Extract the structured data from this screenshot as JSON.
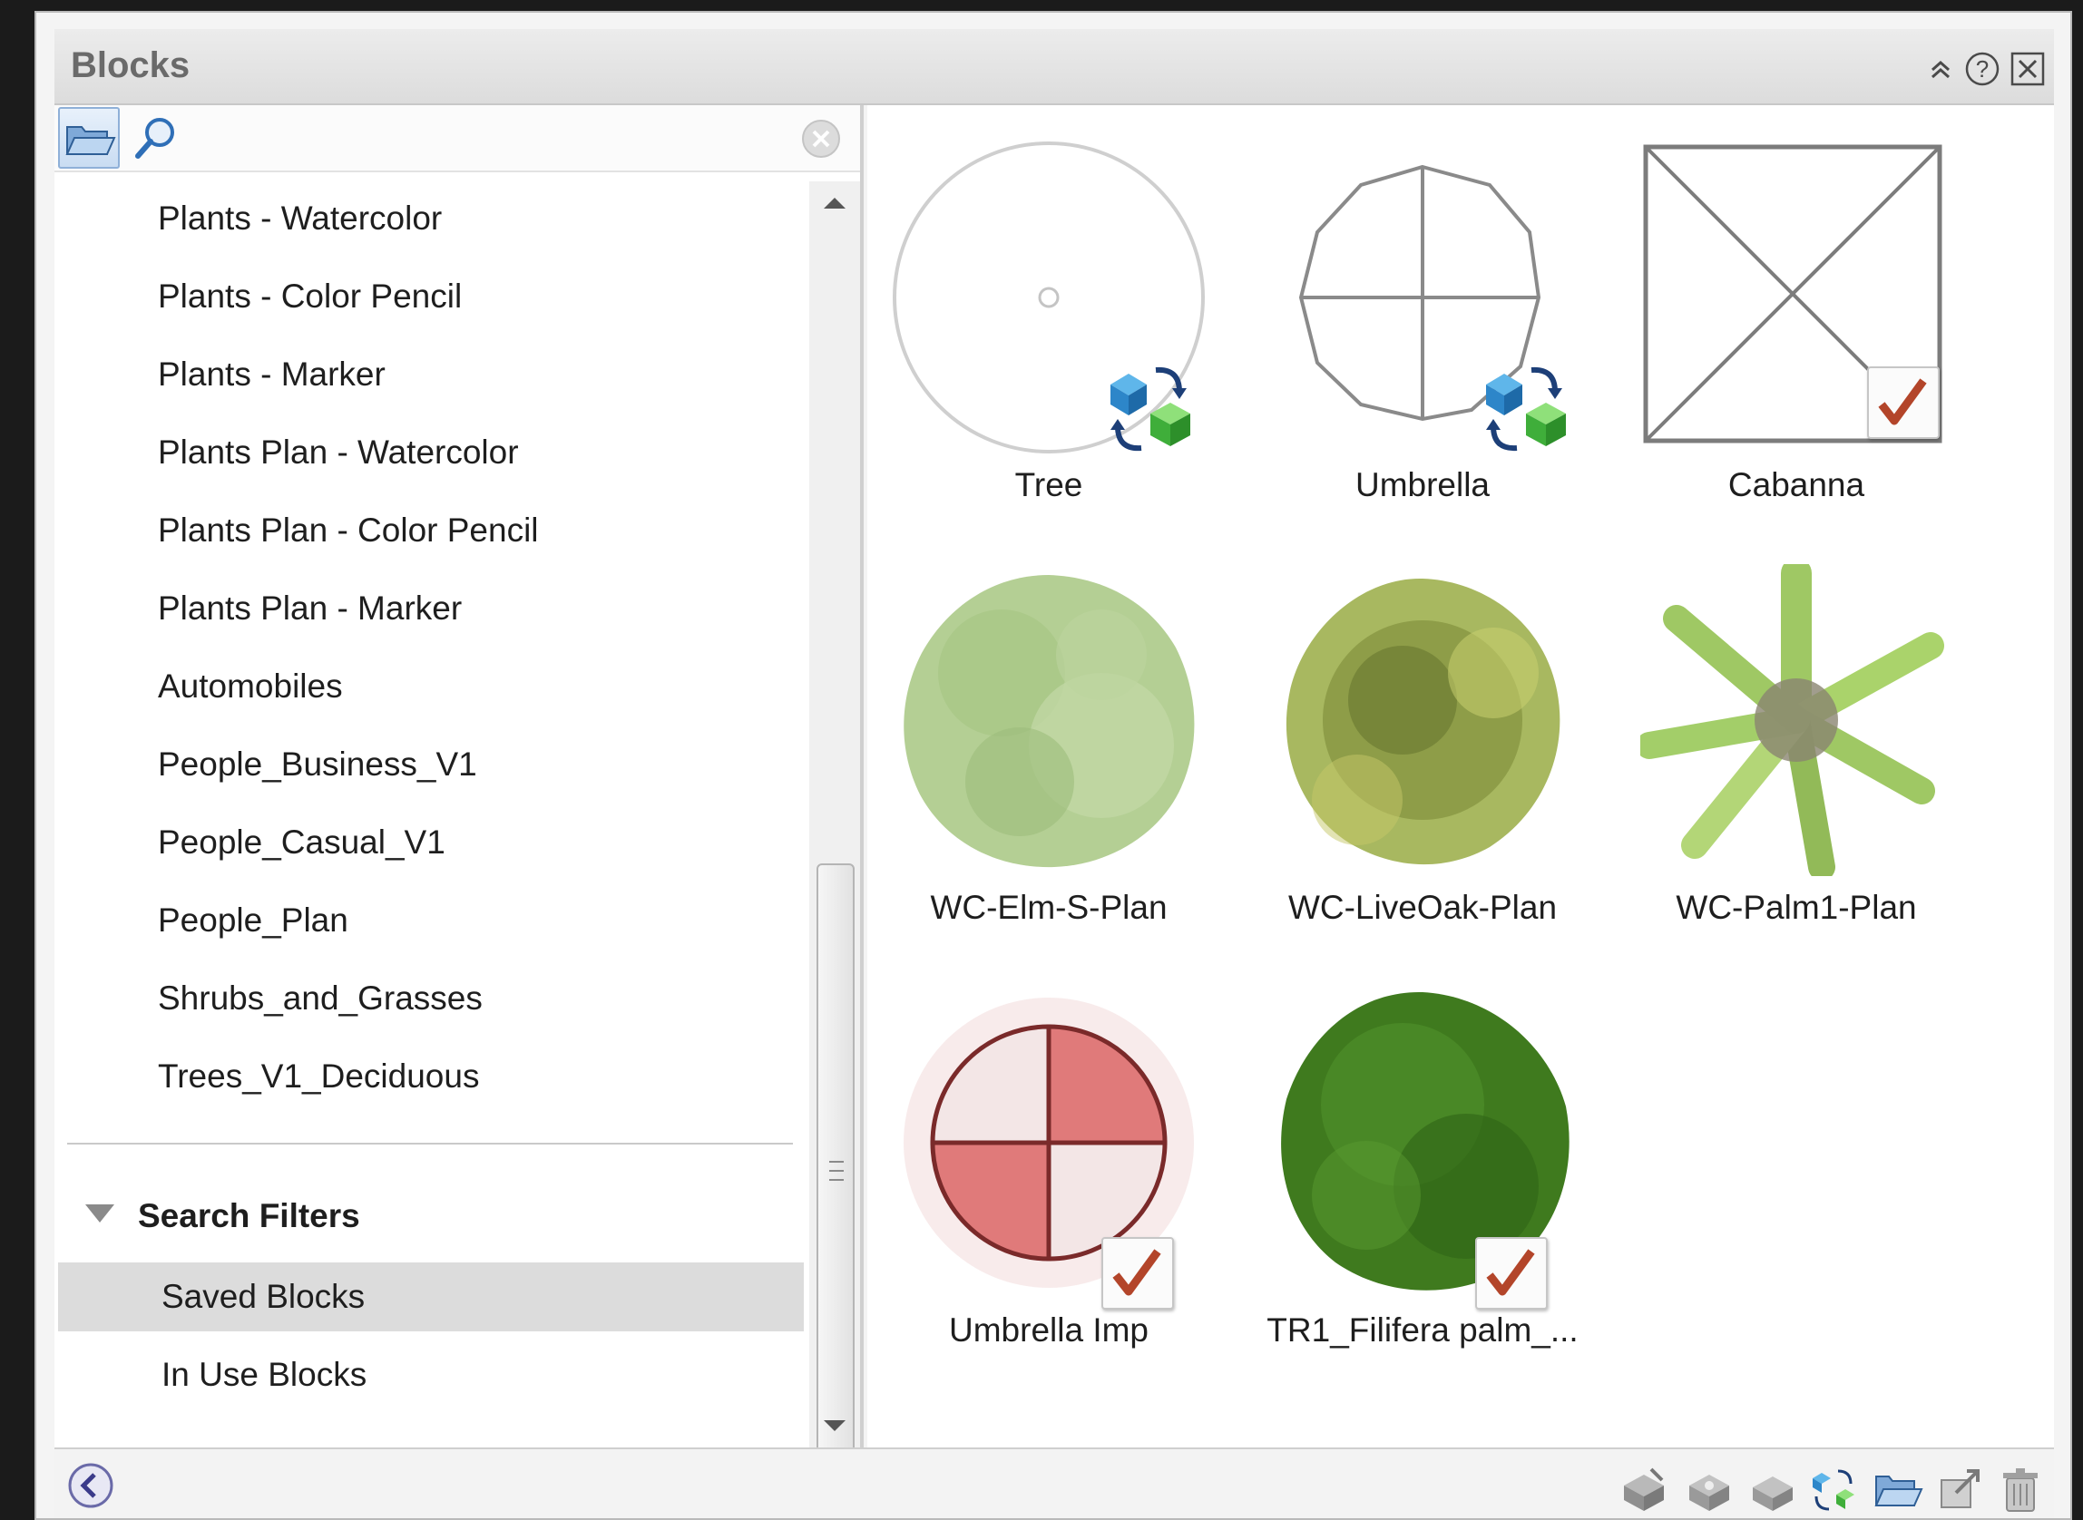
{
  "panel": {
    "title": "Blocks"
  },
  "window_controls": [
    "collapse-icon",
    "help-icon",
    "close-icon"
  ],
  "toolbar": {
    "folder_icon": "folder-open-icon",
    "search_icon": "magnifier-icon",
    "search_placeholder": "",
    "clear_icon": "clear-icon"
  },
  "libraries": [
    "Plants - Watercolor",
    "Plants - Color Pencil",
    "Plants - Marker",
    "Plants Plan - Watercolor",
    "Plants Plan - Color Pencil",
    "Plants Plan - Marker",
    "Automobiles",
    "People_Business_V1",
    "People_Casual_V1",
    "People_Plan",
    "Shrubs_and_Grasses",
    "Trees_V1_Deciduous"
  ],
  "search_filters": {
    "label": "Search Filters",
    "items": [
      {
        "label": "Saved Blocks",
        "selected": true
      },
      {
        "label": "In Use Blocks",
        "selected": false
      }
    ]
  },
  "blocks": [
    {
      "label": "Tree",
      "badge": "sync-icon"
    },
    {
      "label": "Umbrella",
      "badge": "sync-icon"
    },
    {
      "label": "Cabanna",
      "badge": "checkmark-icon"
    },
    {
      "label": "WC-Elm-S-Plan",
      "badge": ""
    },
    {
      "label": "WC-LiveOak-Plan",
      "badge": ""
    },
    {
      "label": "WC-Palm1-Plan",
      "badge": ""
    },
    {
      "label": "Umbrella Imp",
      "badge": "checkmark-icon"
    },
    {
      "label": "TR1_Filifera palm_...",
      "badge": "checkmark-icon"
    }
  ],
  "bottom_toolbar": {
    "nav_icon": "back-arrow-icon",
    "icons": [
      "place-block-icon",
      "explode-block-icon",
      "edit-block-icon",
      "sync-icon",
      "folder-icon",
      "export-icon",
      "trash-icon"
    ]
  },
  "colors": {
    "selected_row": "#dcdcdc",
    "accent_blue": "#2f6fb7",
    "check_red": "#b3452a"
  }
}
